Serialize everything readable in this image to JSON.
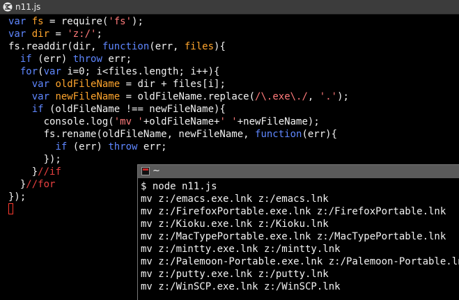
{
  "editor": {
    "title": "n11.js",
    "lines": [
      [
        {
          "t": "var",
          "c": "kw"
        },
        {
          "t": " ",
          "c": "plain"
        },
        {
          "t": "fs",
          "c": "var"
        },
        {
          "t": " = require(",
          "c": "plain"
        },
        {
          "t": "'fs'",
          "c": "str"
        },
        {
          "t": ");",
          "c": "plain"
        }
      ],
      [
        {
          "t": "var",
          "c": "kw"
        },
        {
          "t": " ",
          "c": "plain"
        },
        {
          "t": "dir",
          "c": "var"
        },
        {
          "t": " = ",
          "c": "plain"
        },
        {
          "t": "'z:/'",
          "c": "str"
        },
        {
          "t": ";",
          "c": "plain"
        }
      ],
      [
        {
          "t": "fs.readdir(dir, ",
          "c": "plain"
        },
        {
          "t": "function",
          "c": "kw"
        },
        {
          "t": "(err, ",
          "c": "plain"
        },
        {
          "t": "files",
          "c": "var"
        },
        {
          "t": "){",
          "c": "plain"
        }
      ],
      [
        {
          "t": "  ",
          "c": "plain"
        },
        {
          "t": "if",
          "c": "kw"
        },
        {
          "t": " (err) ",
          "c": "plain"
        },
        {
          "t": "throw",
          "c": "kw"
        },
        {
          "t": " err;",
          "c": "plain"
        }
      ],
      [
        {
          "t": "  ",
          "c": "plain"
        },
        {
          "t": "for",
          "c": "kw"
        },
        {
          "t": "(",
          "c": "plain"
        },
        {
          "t": "var",
          "c": "kw"
        },
        {
          "t": " i=0; i<files.length; i++){",
          "c": "plain"
        }
      ],
      [
        {
          "t": "    ",
          "c": "plain"
        },
        {
          "t": "var",
          "c": "kw"
        },
        {
          "t": " ",
          "c": "plain"
        },
        {
          "t": "oldFileName",
          "c": "var"
        },
        {
          "t": " = dir + files[i];",
          "c": "plain"
        }
      ],
      [
        {
          "t": "    ",
          "c": "plain"
        },
        {
          "t": "var",
          "c": "kw"
        },
        {
          "t": " ",
          "c": "plain"
        },
        {
          "t": "newFileName",
          "c": "var"
        },
        {
          "t": " = oldFileName.replace(",
          "c": "plain"
        },
        {
          "t": "/\\.exe\\./",
          "c": "str"
        },
        {
          "t": ", ",
          "c": "plain"
        },
        {
          "t": "'.'",
          "c": "str"
        },
        {
          "t": ");",
          "c": "plain"
        }
      ],
      [
        {
          "t": "    ",
          "c": "plain"
        },
        {
          "t": "if",
          "c": "kw"
        },
        {
          "t": " (oldFileName !== newFileName){",
          "c": "plain"
        }
      ],
      [
        {
          "t": "      console.log(",
          "c": "plain"
        },
        {
          "t": "'mv '",
          "c": "str"
        },
        {
          "t": "+oldFileName+",
          "c": "plain"
        },
        {
          "t": "' '",
          "c": "str"
        },
        {
          "t": "+newFileName);",
          "c": "plain"
        }
      ],
      [
        {
          "t": "      fs.rename(oldFileName, newFileName, ",
          "c": "plain"
        },
        {
          "t": "function",
          "c": "kw"
        },
        {
          "t": "(err){",
          "c": "plain"
        }
      ],
      [
        {
          "t": "        ",
          "c": "plain"
        },
        {
          "t": "if",
          "c": "kw"
        },
        {
          "t": " (err) ",
          "c": "plain"
        },
        {
          "t": "throw",
          "c": "kw"
        },
        {
          "t": " err;",
          "c": "plain"
        }
      ],
      [
        {
          "t": "      });",
          "c": "plain"
        }
      ],
      [
        {
          "t": "    }",
          "c": "plain"
        },
        {
          "t": "//if",
          "c": "cmt"
        }
      ],
      [
        {
          "t": "  }",
          "c": "plain"
        },
        {
          "t": "//for",
          "c": "cmt"
        }
      ],
      [
        {
          "t": "});",
          "c": "plain"
        }
      ]
    ]
  },
  "terminal": {
    "title": "~",
    "lines": [
      "$ node n11.js",
      "mv z:/emacs.exe.lnk z:/emacs.lnk",
      "mv z:/FirefoxPortable.exe.lnk z:/FirefoxPortable.lnk",
      "mv z:/Kioku.exe.lnk z:/Kioku.lnk",
      "mv z:/MacTypePortable.exe.lnk z:/MacTypePortable.lnk",
      "mv z:/mintty.exe.lnk z:/mintty.lnk",
      "mv z:/Palemoon-Portable.exe.lnk z:/Palemoon-Portable.lnk",
      "mv z:/putty.exe.lnk z:/putty.lnk",
      "mv z:/WinSCP.exe.lnk z:/WinSCP.lnk"
    ]
  },
  "colors": {
    "keyword": "#5f87ff",
    "variable": "#ffa52d",
    "string": "#ff7a7a",
    "comment": "#e84040",
    "text": "#f2f2f2",
    "background": "#000000"
  }
}
